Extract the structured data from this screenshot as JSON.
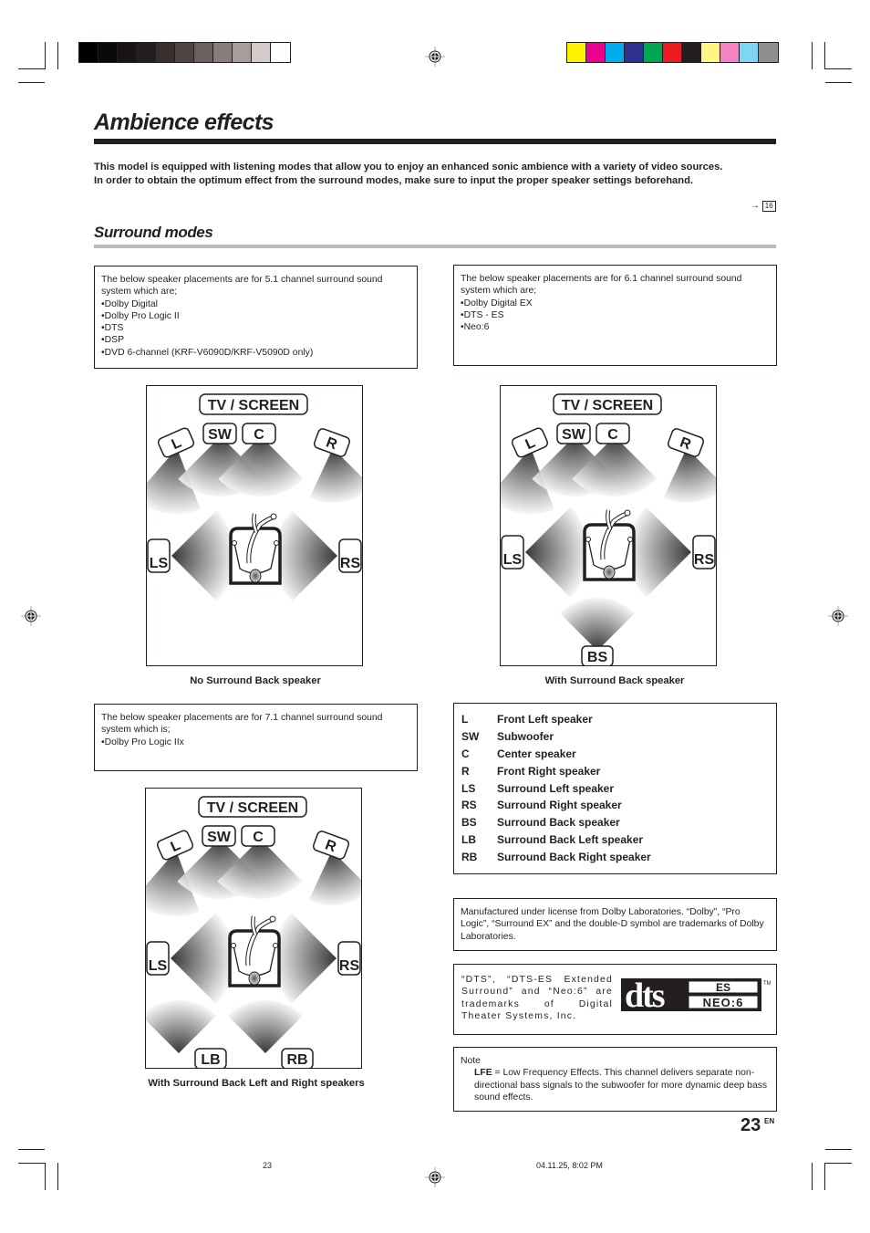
{
  "colors": {
    "ink": "#231f20",
    "gray_swatches": [
      "#000000",
      "#0b0908",
      "#171413",
      "#231f20",
      "#37302e",
      "#4d4542",
      "#6a605d",
      "#877d7a",
      "#a59e9b",
      "#d3cccb",
      "#ffffff"
    ],
    "color_swatches": [
      "#fff200",
      "#ec008c",
      "#00aeef",
      "#2e3192",
      "#00a651",
      "#ed1c24",
      "#231f20",
      "#fff685",
      "#f284c4",
      "#7dd6f6",
      "#8f8f8f"
    ],
    "subrule": "#bcbcbc"
  },
  "page": {
    "title": "Ambience effects",
    "intro_lines": [
      "This model is equipped with listening modes that allow you to enjoy an enhanced sonic ambience with a variety of video sources.",
      "In order to obtain the optimum effect from the surround modes, make sure to input the proper speaker settings beforehand."
    ],
    "page_ref_arrow": "→",
    "page_ref": "16",
    "section_title": "Surround modes",
    "page_number": "23",
    "page_lang": "EN"
  },
  "systems": {
    "five_one": {
      "intro": "The below speaker placements are for 5.1 channel surround sound system which are;",
      "items": [
        "Dolby Digital",
        "Dolby Pro Logic II",
        "DTS",
        "DSP",
        "DVD 6-channel (KRF-V6090D/KRF-V5090D only)"
      ]
    },
    "six_one": {
      "intro": "The below speaker placements are for 6.1 channel surround sound system which are;",
      "items": [
        "Dolby Digital EX",
        "DTS - ES",
        "Neo:6"
      ]
    },
    "seven_one": {
      "intro": "The below speaker placements are for 7.1 channel surround sound system which is;",
      "items": [
        "Dolby Pro Logic IIx"
      ]
    }
  },
  "diagrams": {
    "screen_label": "TV / SCREEN",
    "labels": {
      "L": "L",
      "SW": "SW",
      "C": "C",
      "R": "R",
      "LS": "LS",
      "RS": "RS",
      "BS": "BS",
      "LB": "LB",
      "RB": "RB"
    },
    "captions": {
      "no_back": "No Surround Back speaker",
      "with_back": "With Surround Back speaker",
      "with_back_lr": "With Surround Back Left and Right speakers"
    }
  },
  "legend": [
    {
      "code": "L",
      "desc": "Front Left speaker"
    },
    {
      "code": "SW",
      "desc": "Subwoofer"
    },
    {
      "code": "C",
      "desc": "Center speaker"
    },
    {
      "code": "R",
      "desc": "Front Right speaker"
    },
    {
      "code": "LS",
      "desc": "Surround Left speaker"
    },
    {
      "code": "RS",
      "desc": "Surround Right speaker"
    },
    {
      "code": "BS",
      "desc": "Surround Back speaker"
    },
    {
      "code": "LB",
      "desc": "Surround Back Left speaker"
    },
    {
      "code": "RB",
      "desc": "Surround Back Right speaker"
    }
  ],
  "dolby_notice": "Manufactured under license  from Dolby Laboratories. “Dolby”, “Pro Logic”, “Surround EX” and the double-D symbol are trademarks of Dolby Laboratories.",
  "dts_notice": "“DTS”, “DTS-ES Extended Surround” and “Neo:6” are trademarks of Digital Theater Systems, Inc.",
  "dts_logo": {
    "main": "dts",
    "top": "ES",
    "bottom": "NEO:6",
    "tm": "TM"
  },
  "note": {
    "heading": "Note",
    "term": "LFE",
    "text": " = Low Frequency Effects. This channel delivers separate non-directional bass signals to the subwoofer for more dynamic deep bass sound effects."
  },
  "footer": {
    "page": "23",
    "timestamp": "04.11.25, 8:02 PM"
  }
}
